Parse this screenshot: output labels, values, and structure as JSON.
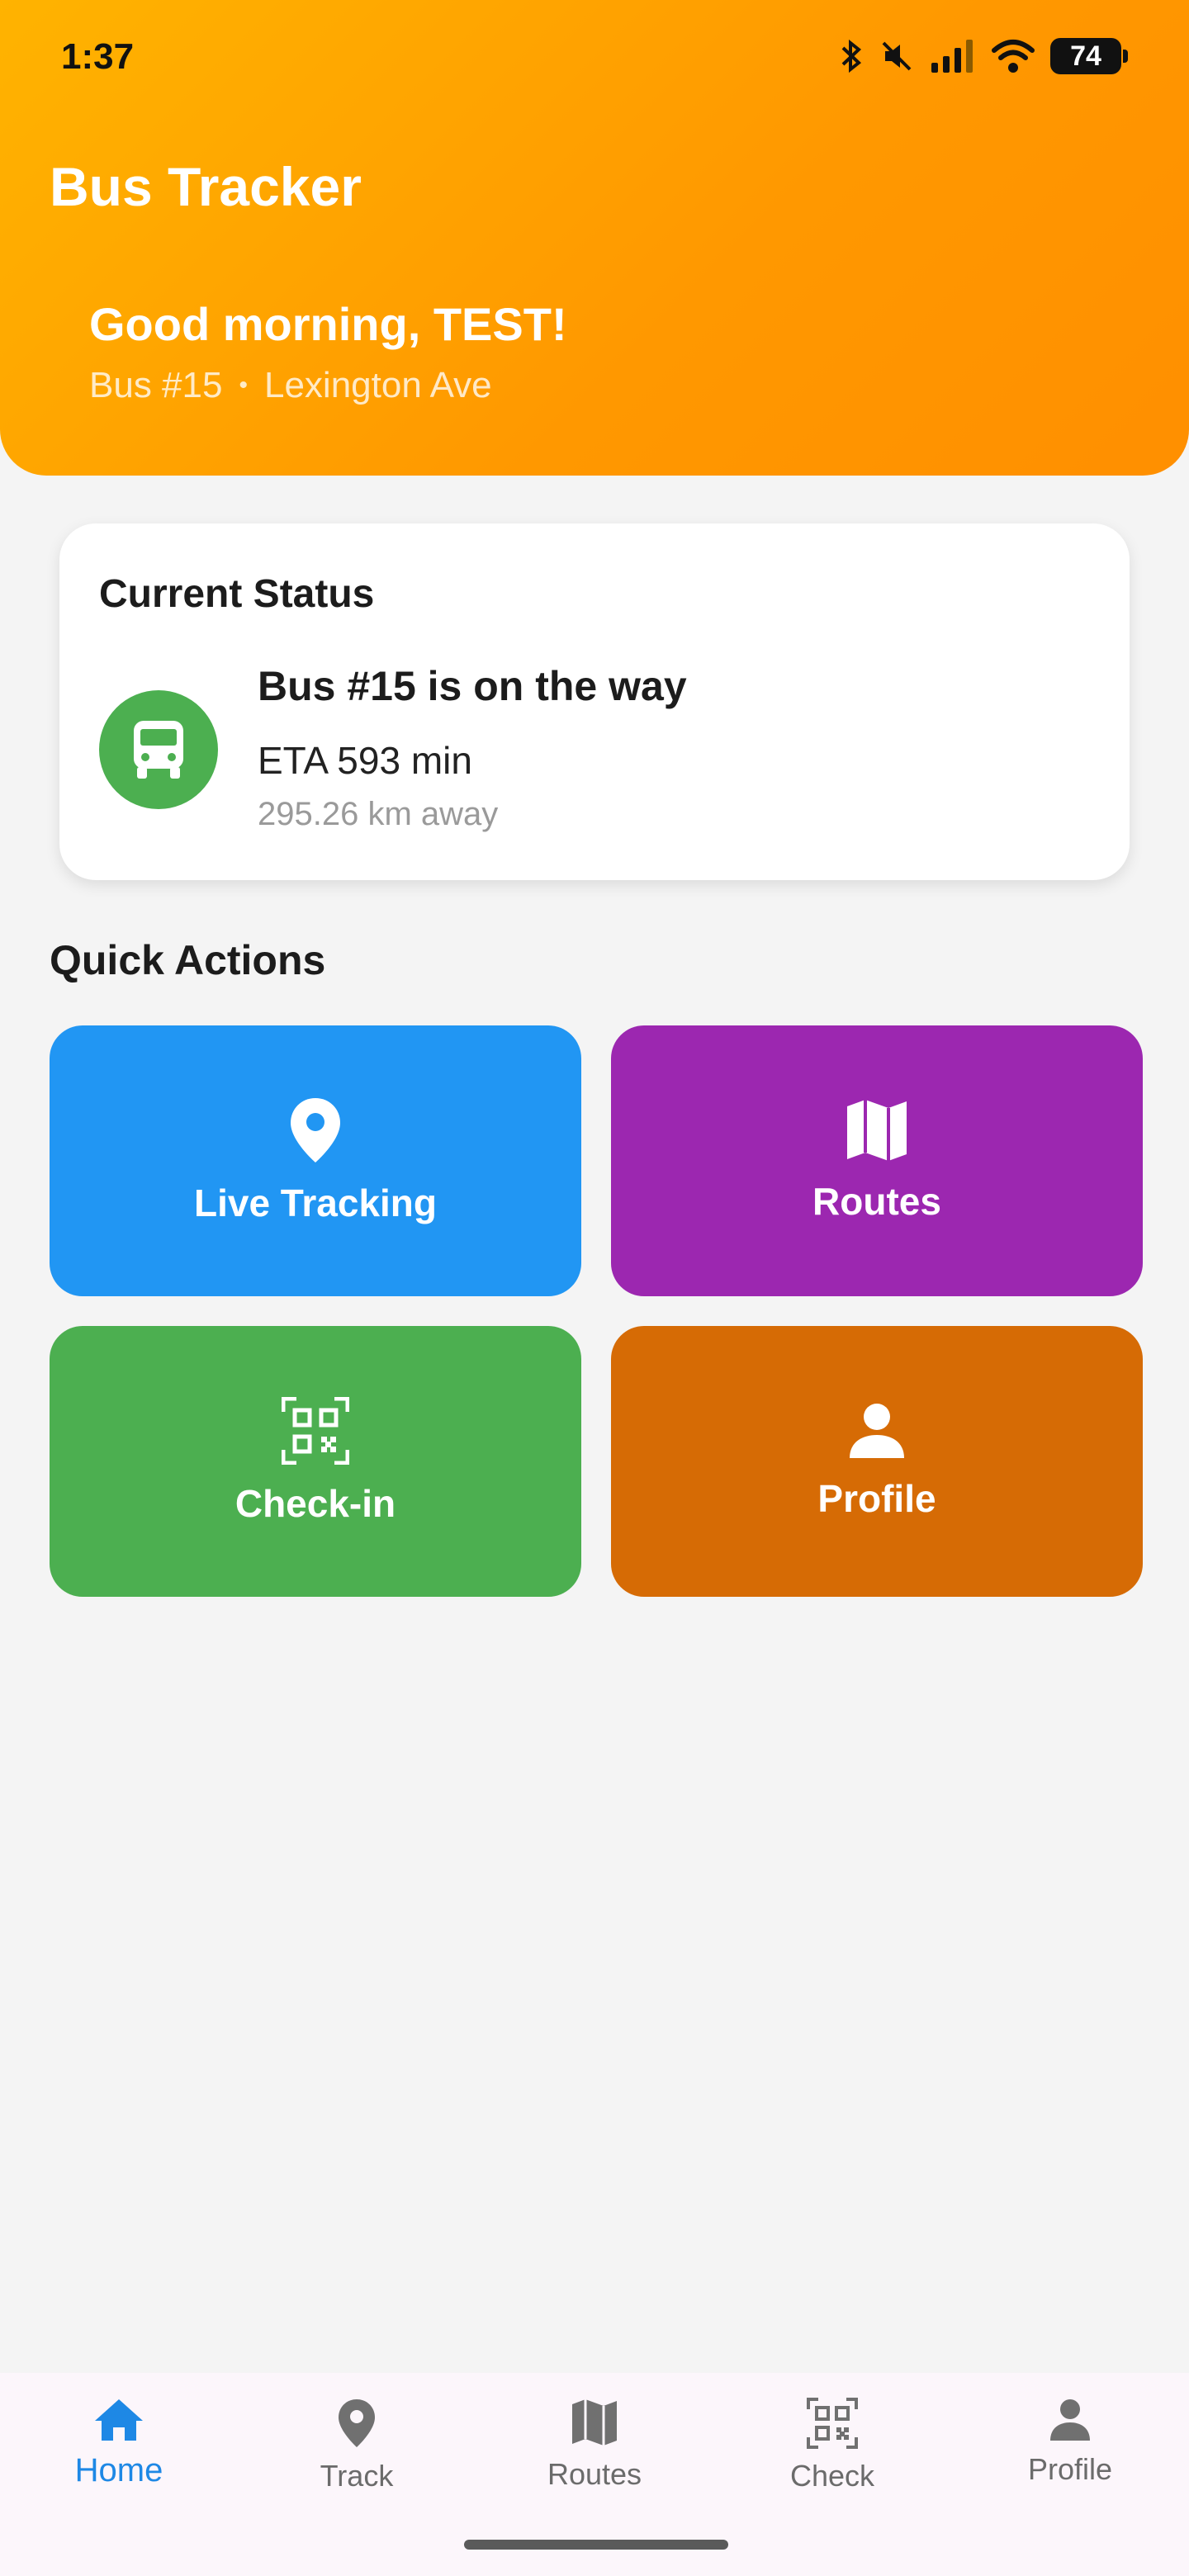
{
  "status_bar": {
    "time": "1:37",
    "battery": "74"
  },
  "header": {
    "app_title": "Bus Tracker",
    "greeting": "Good morning, TEST!",
    "bus_label": "Bus #15",
    "separator": "•",
    "route_stop": "Lexington Ave"
  },
  "status_card": {
    "title": "Current Status",
    "headline": "Bus #15 is on the way",
    "eta": "ETA 593 min",
    "distance": "295.26 km away",
    "icon": "bus-icon"
  },
  "quick_actions": {
    "title": "Quick Actions",
    "tiles": [
      {
        "label": "Live Tracking",
        "icon": "location-pin-icon",
        "color": "#2196f3"
      },
      {
        "label": "Routes",
        "icon": "map-icon",
        "color": "#9c27b0"
      },
      {
        "label": "Check-in",
        "icon": "qr-code-icon",
        "color": "#4caf50"
      },
      {
        "label": "Profile",
        "icon": "person-icon",
        "color": "#d66b05"
      }
    ]
  },
  "bottom_nav": {
    "items": [
      {
        "label": "Home",
        "icon": "home-icon",
        "active": true
      },
      {
        "label": "Track",
        "icon": "location-pin-icon"
      },
      {
        "label": "Routes",
        "icon": "map-icon"
      },
      {
        "label": "Check",
        "icon": "qr-code-icon"
      },
      {
        "label": "Profile",
        "icon": "person-icon"
      }
    ]
  },
  "colors": {
    "header_start": "#ffb300",
    "header_end": "#ff8f00",
    "accent": "#1e88e5",
    "bus_green": "#4caf50"
  }
}
